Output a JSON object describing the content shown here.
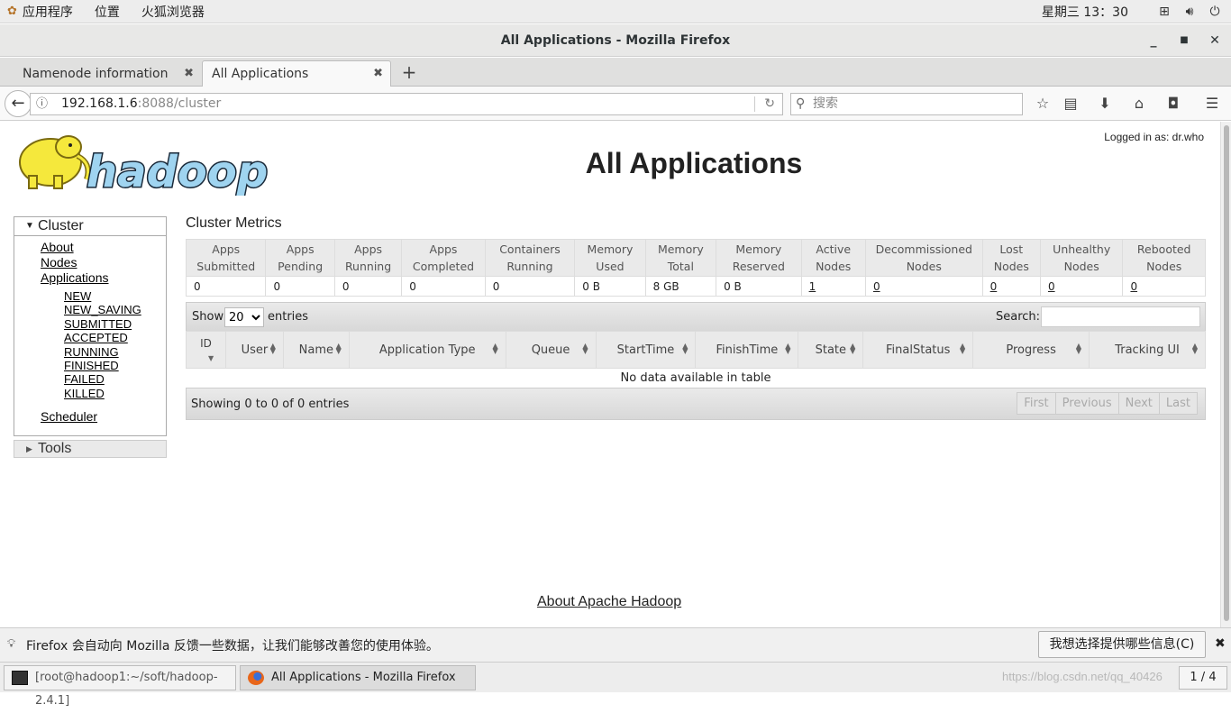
{
  "gnome": {
    "apps_menu": "应用程序",
    "places_menu": "位置",
    "firefox_menu": "火狐浏览器",
    "clock": "星期三 13：30"
  },
  "window": {
    "title": "All Applications - Mozilla Firefox"
  },
  "tabs": [
    {
      "label": "Namenode information"
    },
    {
      "label": "All Applications"
    }
  ],
  "nav": {
    "url_host": "192.168.1.6",
    "url_path": ":8088/cluster",
    "search_placeholder": "搜索"
  },
  "page": {
    "logged_in": "Logged in as: dr.who",
    "title": "All Applications",
    "logo_text": "hadoop",
    "sidebar": {
      "cluster_label": "Cluster",
      "links": [
        "About",
        "Nodes",
        "Applications"
      ],
      "app_states": [
        "NEW",
        "NEW_SAVING",
        "SUBMITTED",
        "ACCEPTED",
        "RUNNING",
        "FINISHED",
        "FAILED",
        "KILLED"
      ],
      "scheduler": "Scheduler",
      "tools_label": "Tools"
    },
    "metrics": {
      "title": "Cluster Metrics",
      "headers": [
        [
          "Apps",
          "Submitted"
        ],
        [
          "Apps",
          "Pending"
        ],
        [
          "Apps",
          "Running"
        ],
        [
          "Apps",
          "Completed"
        ],
        [
          "Containers",
          "Running"
        ],
        [
          "Memory",
          "Used"
        ],
        [
          "Memory",
          "Total"
        ],
        [
          "Memory",
          "Reserved"
        ],
        [
          "Active",
          "Nodes"
        ],
        [
          "Decommissioned",
          "Nodes"
        ],
        [
          "Lost",
          "Nodes"
        ],
        [
          "Unhealthy",
          "Nodes"
        ],
        [
          "Rebooted",
          "Nodes"
        ]
      ],
      "values": [
        "0",
        "0",
        "0",
        "0",
        "0",
        "0 B",
        "8 GB",
        "0 B",
        "1",
        "0",
        "0",
        "0",
        "0"
      ]
    },
    "apps_table": {
      "show_label": "Show",
      "page_size": "20",
      "entries_label": "entries",
      "search_label": "Search:",
      "columns": [
        "ID",
        "User",
        "Name",
        "Application Type",
        "Queue",
        "StartTime",
        "FinishTime",
        "State",
        "FinalStatus",
        "Progress",
        "Tracking UI"
      ],
      "empty_message": "No data available in table",
      "info": "Showing 0 to 0 of 0 entries",
      "pager": [
        "First",
        "Previous",
        "Next",
        "Last"
      ]
    },
    "footer_link": "About Apache Hadoop"
  },
  "notification": {
    "message": "Firefox 会自动向 Mozilla 反馈一些数据，让我们能够改善您的使用体验。",
    "button": "我想选择提供哪些信息(C)"
  },
  "taskbar": {
    "terminal": "[root@hadoop1:~/soft/hadoop-2.4.1]",
    "firefox": "All Applications - Mozilla Firefox",
    "workspace": "1 / 4",
    "watermark": "https://blog.csdn.net/qq_40426"
  },
  "colors": {
    "hadoop_yellow": "#f5e83c",
    "hadoop_blue": "#9fd4f0",
    "table_header_bg": "#eaeaea"
  }
}
